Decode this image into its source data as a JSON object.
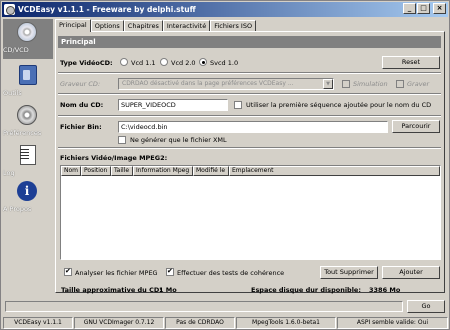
{
  "window": {
    "title": "VCDEasy v1.1.1 - Freeware by delphi.stuff"
  },
  "sidebar": {
    "items": [
      {
        "label": "CD/VCD",
        "icon": "disc-icon"
      },
      {
        "label": "Outils",
        "icon": "tools-icon"
      },
      {
        "label": "Préférences",
        "icon": "preferences-disc-icon"
      },
      {
        "label": "Log",
        "icon": "log-document-icon"
      },
      {
        "label": "A Propos",
        "icon": "info-icon"
      }
    ]
  },
  "tabs": [
    "Principal",
    "Options",
    "Chapitres",
    "Interactivité",
    "Fichiers ISO"
  ],
  "panel": {
    "header": "Principal",
    "type_label": "Type VidéoCD:",
    "radios": [
      "Vcd 1.1",
      "Vcd 2.0",
      "Svcd 1.0"
    ],
    "selected_type": "Svcd 1.0",
    "reset_label": "Reset",
    "graveur_label": "Graveur CD:",
    "graveur_value": "CDRDAO désactivé dans la page préférences VCDEasy ...",
    "simulation_label": "Simulation",
    "graver_label": "Graver",
    "nom_label": "Nom du CD:",
    "nom_value": "SUPER_VIDEOCD",
    "first_seq_label": "Utiliser la première séquence ajoutée pour le nom du CD",
    "fichier_bin_label": "Fichier Bin:",
    "fichier_bin_value": "C:\\videocd.bin",
    "parcourir_label": "Parcourir",
    "xml_only_label": "Ne générer que le fichier XML",
    "list_title": "Fichiers Vidéo/Image MPEG2:",
    "columns": [
      "Nom",
      "Position",
      "Taille",
      "Information Mpeg",
      "Modifié le",
      "Emplacement"
    ],
    "analyse_label": "Analyser les fichier MPEG",
    "coherence_label": "Effectuer des tests de cohérence",
    "tout_supprimer_label": "Tout Supprimer",
    "ajouter_label": "Ajouter"
  },
  "footer": {
    "taille_label": "Taille approximative du CD:",
    "taille_value": "1 Mo",
    "espace_label": "Espace disque dur disponible:",
    "espace_value": "3386 Mo",
    "go_label": "Go"
  },
  "statusbar": [
    "VCDEasy v1.1.1",
    "GNU VCDImager 0.7.12",
    "Pas de CDRDAO",
    "MpegTools 1.6.0-beta1",
    "ASPI semble valide: Oui"
  ]
}
